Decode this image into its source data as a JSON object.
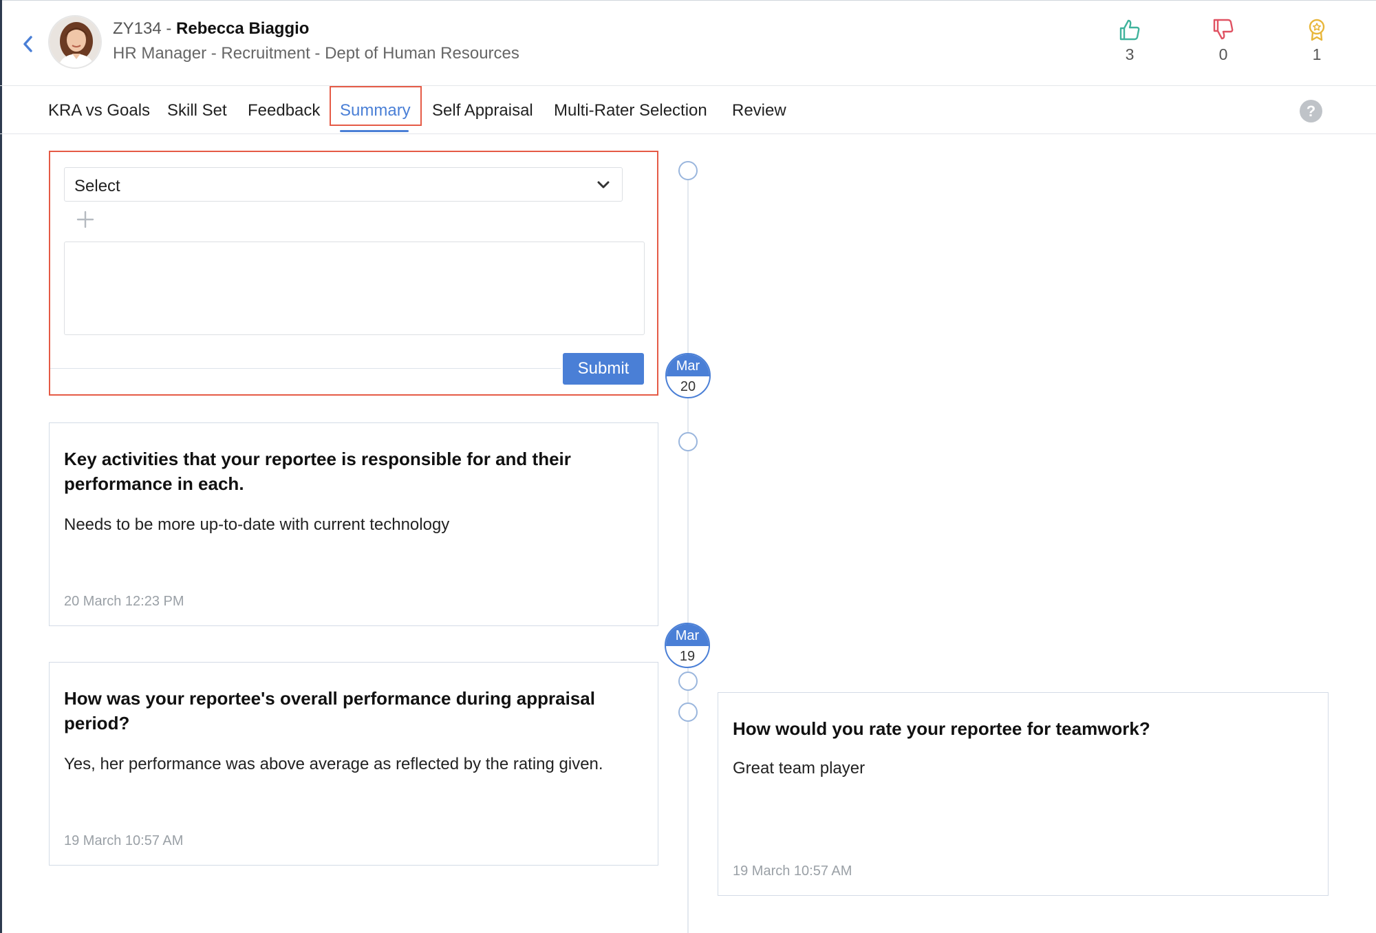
{
  "header": {
    "employee_id": "ZY134",
    "separator": " - ",
    "employee_name": "Rebecca Biaggio",
    "designation": "HR Manager - Recruitment - Dept of Human Resources",
    "stats": {
      "likes": "3",
      "dislikes": "0",
      "awards": "1"
    }
  },
  "tabs": [
    {
      "label": "KRA vs Goals",
      "active": false
    },
    {
      "label": "Skill Set",
      "active": false
    },
    {
      "label": "Feedback",
      "active": false
    },
    {
      "label": "Summary",
      "active": true
    },
    {
      "label": "Self Appraisal",
      "active": false
    },
    {
      "label": "Multi-Rater Selection",
      "active": false
    },
    {
      "label": "Review",
      "active": false
    }
  ],
  "help_label": "?",
  "compose": {
    "select_value": "Select",
    "textarea_value": "",
    "submit_label": "Submit"
  },
  "timeline": {
    "dates": [
      {
        "month": "Mar",
        "day": "20"
      },
      {
        "month": "Mar",
        "day": "19"
      }
    ]
  },
  "cards": [
    {
      "question": "Key activities that your reportee is responsible for and their performance in each.",
      "answer": "Needs to be more up-to-date with current technology",
      "timestamp": "20 March 12:23 PM"
    },
    {
      "question": "How was your reportee's overall performance during appraisal period?",
      "answer": "Yes, her performance was above average as reflected by the rating given.",
      "timestamp": "19 March 10:57 AM"
    },
    {
      "question": "How would you rate your reportee for teamwork?",
      "answer": "Great team player",
      "timestamp": "19 March 10:57 AM"
    }
  ],
  "colors": {
    "accent": "#4a7fd6",
    "highlight_outline": "#e55a45",
    "like": "#3fb39c",
    "dislike": "#e05262",
    "award": "#e8b63a"
  },
  "icons": {
    "back": "chevron-left-icon",
    "add": "plus-icon",
    "dropdown": "chevron-down-icon",
    "like": "thumbs-up-icon",
    "dislike": "thumbs-down-icon",
    "award": "award-badge-icon",
    "help": "help-icon"
  }
}
